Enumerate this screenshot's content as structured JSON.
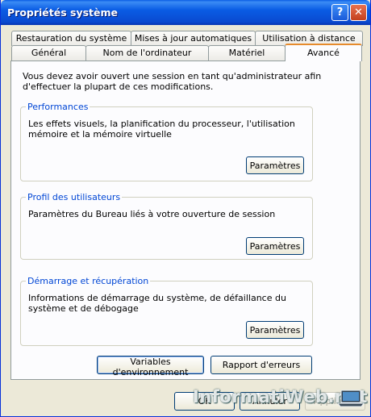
{
  "window": {
    "title": "Propriétés système",
    "help_glyph": "?",
    "close_glyph": "✕"
  },
  "tabs_row1": [
    {
      "label": "Restauration du système"
    },
    {
      "label": "Mises à jour automatiques"
    },
    {
      "label": "Utilisation à distance"
    }
  ],
  "tabs_row2": [
    {
      "label": "Général"
    },
    {
      "label": "Nom de l'ordinateur"
    },
    {
      "label": "Matériel"
    },
    {
      "label": "Avancé",
      "active": true
    }
  ],
  "advanced": {
    "intro": "Vous devez avoir ouvert une session en tant qu'administrateur afin d'effectuer la plupart de ces modifications.",
    "performances": {
      "title": "Performances",
      "text": "Les effets visuels, la planification du processeur, l'utilisation mémoire et la mémoire virtuelle",
      "button": "Paramètres"
    },
    "profils": {
      "title": "Profil des utilisateurs",
      "text": "Paramètres du Bureau liés à votre ouverture de session",
      "button": "Paramètres"
    },
    "demarrage": {
      "title": "Démarrage et récupération",
      "text": "Informations de démarrage du système, de défaillance du système et de débogage",
      "button": "Paramètres"
    },
    "env_button": "Variables d'environnement",
    "errors_button": "Rapport d'erreurs"
  },
  "footer": {
    "ok": "OK",
    "cancel": "Annuler",
    "apply": "Appliquer"
  },
  "watermark": "InformatiWeb.net"
}
